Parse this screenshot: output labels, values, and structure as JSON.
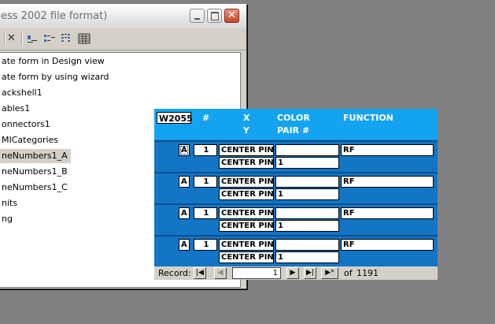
{
  "window": {
    "title": "ess 2002 file format)",
    "close_glyph": "✕"
  },
  "toolbar": {
    "icons": [
      "delete-icon",
      "large-icons-icon",
      "small-icons-icon",
      "list-icon",
      "details-icon"
    ],
    "delete_glyph": "✕"
  },
  "objects": {
    "items": [
      "ate form in Design view",
      "ate form by using wizard",
      "ackshell1",
      "ables1",
      "onnectors1",
      "MICategories",
      "neNumbers1_A",
      "neNumbers1_B",
      "neNumbers1_C",
      "nits",
      "ng"
    ],
    "selected_index": 6
  },
  "form": {
    "code": "W2055",
    "headers": {
      "num": "#",
      "x": "X",
      "y": "Y",
      "color": "COLOR",
      "pair": "PAIR #",
      "function": "FUNCTION"
    },
    "records": [
      {
        "letter": "A",
        "num": "1",
        "x": "CENTER PIN",
        "y": "CENTER PIN",
        "color": "",
        "pair": "1",
        "function": "RF"
      },
      {
        "letter": "A",
        "num": "1",
        "x": "CENTER PIN",
        "y": "CENTER PIN",
        "color": "",
        "pair": "1",
        "function": "RF"
      },
      {
        "letter": "A",
        "num": "1",
        "x": "CENTER PIN",
        "y": "CENTER PIN",
        "color": "",
        "pair": "1",
        "function": "RF"
      },
      {
        "letter": "A",
        "num": "1",
        "x": "CENTER PIN",
        "y": "CENTER PIN",
        "color": "",
        "pair": "1",
        "function": "RF"
      }
    ]
  },
  "navigation": {
    "record_label": "Record:",
    "current": "1",
    "of_label": "of",
    "total": "1191",
    "first_glyph": "|◀",
    "prev_glyph": "◀",
    "next_glyph": "▶",
    "last_glyph": "▶|",
    "new_glyph": "▶*"
  }
}
